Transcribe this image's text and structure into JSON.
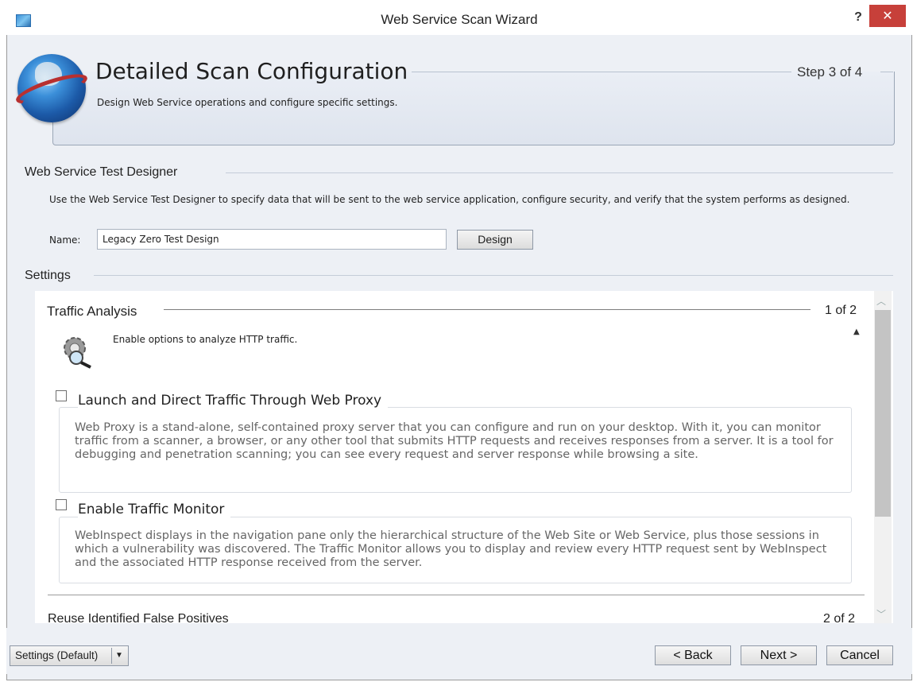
{
  "window": {
    "title": "Web Service Scan Wizard",
    "help_label": "?",
    "close_label": "✕"
  },
  "header": {
    "title": "Detailed Scan Configuration",
    "step": "Step 3 of 4",
    "subtitle": "Design Web Service operations and configure specific settings."
  },
  "designer": {
    "heading": "Web Service Test Designer",
    "description": "Use the Web Service Test Designer to specify data that will be sent to the web service application, configure security, and verify that the system performs as designed.",
    "name_label": "Name:",
    "name_value": "Legacy Zero Test Design",
    "design_button": "Design"
  },
  "settings": {
    "heading": "Settings",
    "traffic_analysis": {
      "title": "Traffic Analysis",
      "count": "1 of 2",
      "description": "Enable options to analyze HTTP traffic.",
      "options": [
        {
          "label": "Launch and Direct Traffic Through Web Proxy",
          "checked": false,
          "text": "Web Proxy is a stand-alone, self-contained proxy server that you can configure and run on your desktop. With it, you can monitor traffic from a scanner, a browser, or any other tool that submits HTTP requests and receives responses from a server. It is a tool for debugging and penetration scanning; you can see every request and server response while browsing a site."
        },
        {
          "label": "Enable Traffic Monitor",
          "checked": false,
          "text": "WebInspect displays in the navigation pane only the hierarchical structure of the Web Site or Web Service, plus those sessions in which a vulnerability was discovered. The Traffic Monitor allows you to display and review every HTTP request sent by WebInspect and the associated HTTP response received from the server."
        }
      ]
    },
    "reuse_false_positives": {
      "title": "Reuse Identified False Positives",
      "count": "2 of 2"
    }
  },
  "footer": {
    "profile_label": "Settings (Default)",
    "back_label": "< Back",
    "next_label": "Next >",
    "cancel_label": "Cancel"
  }
}
